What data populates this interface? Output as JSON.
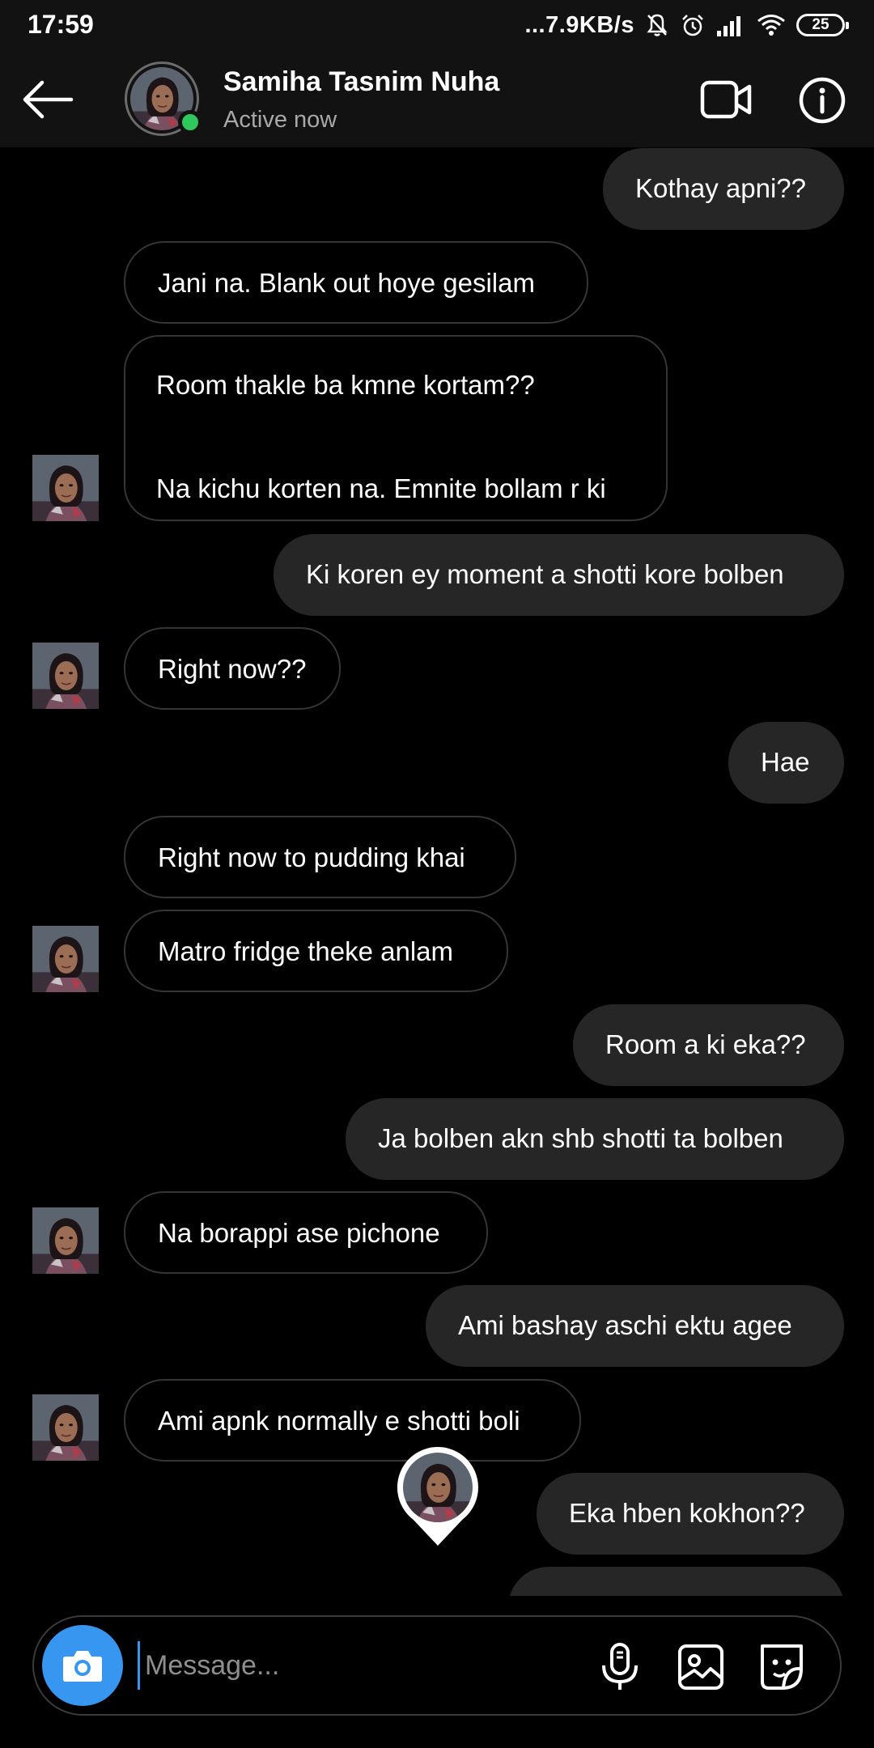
{
  "status_bar": {
    "time": "17:59",
    "network_speed": "...7.9KB/s",
    "battery": "25",
    "icons": [
      "bell-off-icon",
      "alarm-icon",
      "signal-icon",
      "wifi-icon",
      "battery-icon"
    ]
  },
  "header": {
    "contact_name": "Samiha Tasnim Nuha",
    "contact_status": "Active now",
    "icons": [
      "back-arrow-icon",
      "video-call-icon",
      "info-icon"
    ],
    "online_color": "#2ec85c"
  },
  "messages": [
    {
      "direction": "out",
      "text": "Kothay apni??"
    },
    {
      "direction": "in",
      "text": "Jani na. Blank out hoye gesilam"
    },
    {
      "direction": "in",
      "text": "Room thakle ba kmne kortam??\n\nNa kichu korten na. Emnite bollam r ki"
    },
    {
      "direction": "out",
      "text": "Ki koren ey moment a shotti kore bolben"
    },
    {
      "direction": "in",
      "text": "Right now??"
    },
    {
      "direction": "out",
      "text": "Hae"
    },
    {
      "direction": "in",
      "text": "Right now to pudding khai"
    },
    {
      "direction": "in",
      "text": "Matro fridge theke anlam"
    },
    {
      "direction": "out",
      "text": "Room a ki eka??"
    },
    {
      "direction": "out",
      "text": "Ja bolben akn shb shotti ta bolben"
    },
    {
      "direction": "in",
      "text": "Na borappi ase pichone"
    },
    {
      "direction": "out",
      "text": "Ami bashay aschi ektu agee"
    },
    {
      "direction": "in",
      "text": "Ami apnk normally e shotti boli"
    },
    {
      "direction": "out",
      "text": "Eka hben kokhon??"
    }
  ],
  "composer": {
    "placeholder": "Message...",
    "icons": [
      "camera-icon",
      "microphone-icon",
      "gallery-icon",
      "sticker-icon"
    ],
    "accent": "#3797f0"
  },
  "colors": {
    "background": "#000000",
    "header": "#121212",
    "outgoing_bubble": "#262626",
    "incoming_border": "#353535"
  }
}
